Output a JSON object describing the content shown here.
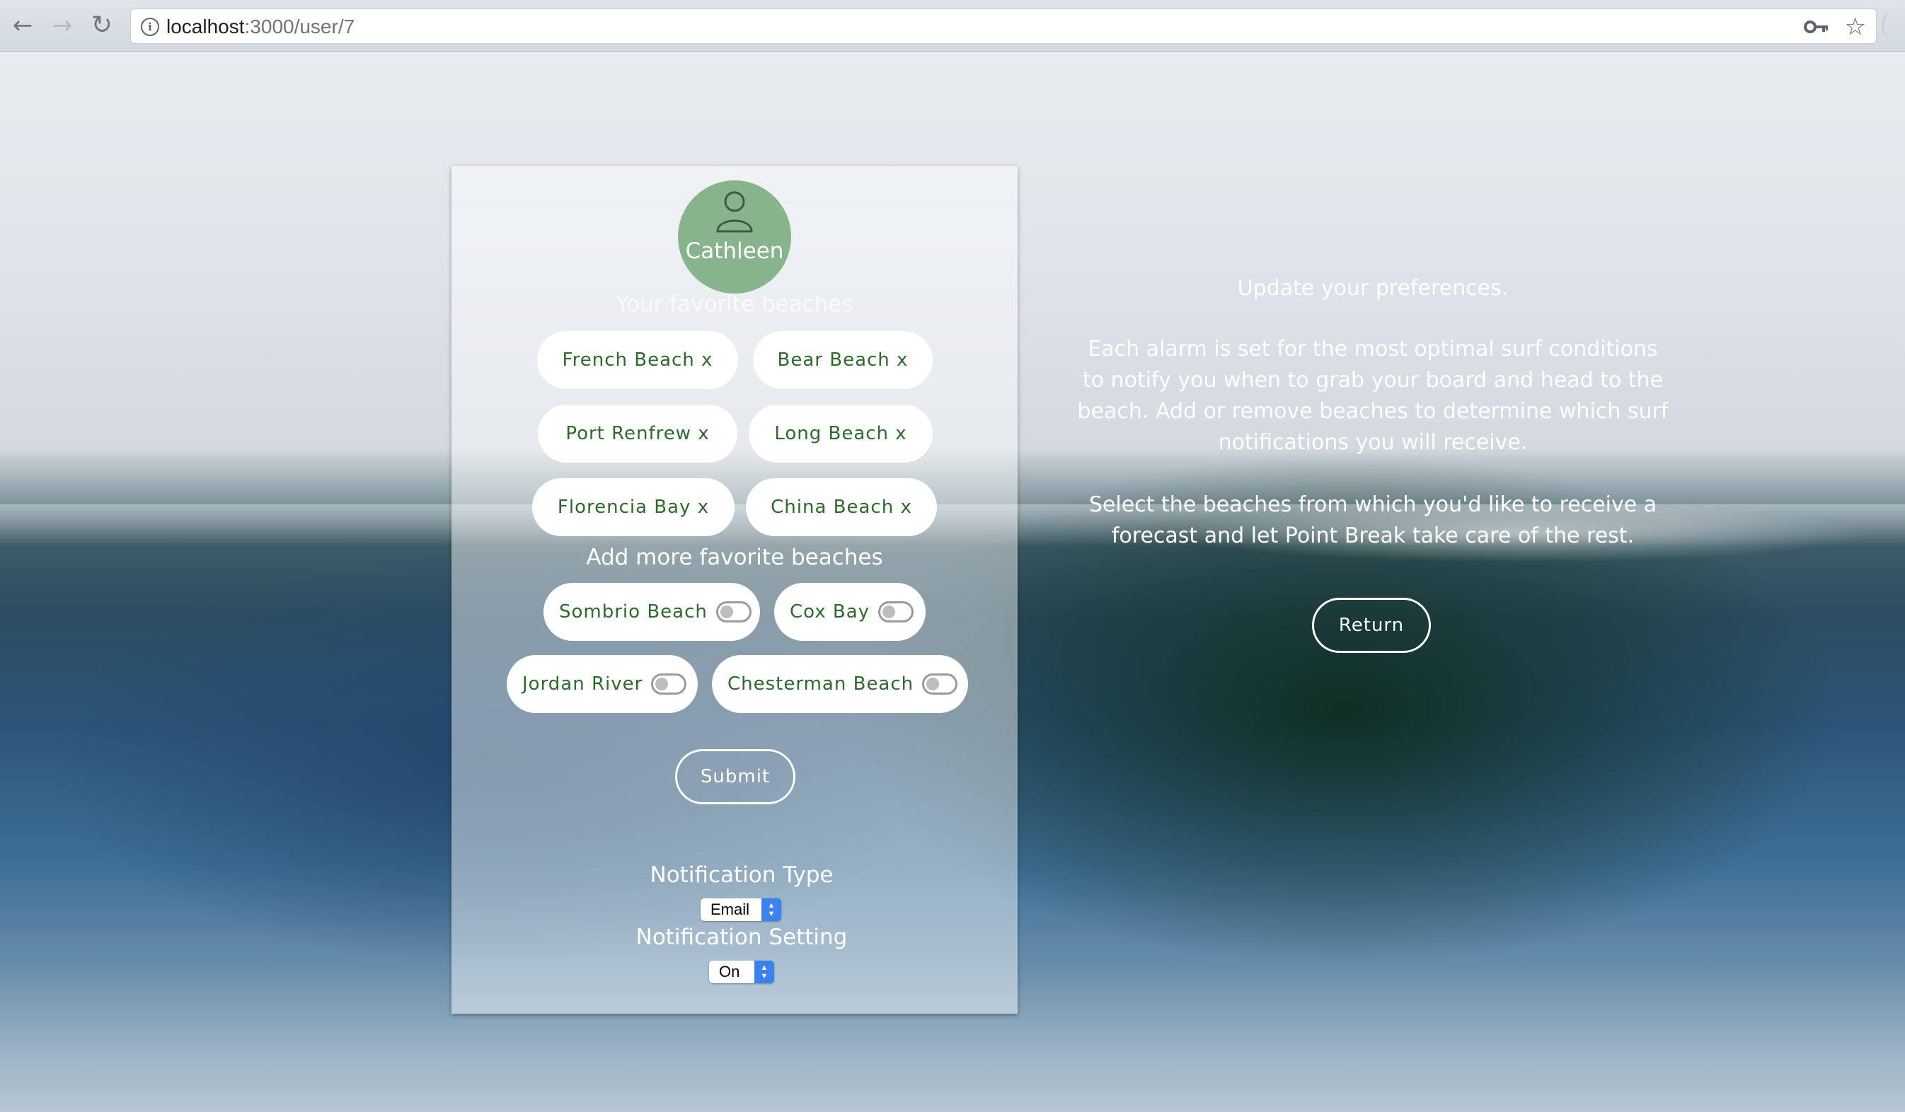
{
  "browser": {
    "url_host": "localhost",
    "url_path": ":3000/user/7",
    "icons": [
      "back-arrow-icon",
      "forward-arrow-icon",
      "reload-icon",
      "info-icon",
      "key-icon",
      "star-icon"
    ]
  },
  "profile": {
    "name": "Cathleen",
    "favorites_title": "Your favorite beaches",
    "favorites": [
      {
        "label": "French Beach x"
      },
      {
        "label": "Bear Beach x"
      },
      {
        "label": "Port Renfrew x"
      },
      {
        "label": "Long Beach x"
      },
      {
        "label": "Florencia Bay x"
      },
      {
        "label": "China Beach x"
      }
    ],
    "add_title": "Add more favorite beaches",
    "add_beaches": [
      {
        "label": "Sombrio Beach",
        "on": false
      },
      {
        "label": "Cox Bay",
        "on": false
      },
      {
        "label": "Jordan River",
        "on": false
      },
      {
        "label": "Chesterman Beach",
        "on": false
      }
    ],
    "submit_label": "Submit",
    "notification_type_label": "Notification Type",
    "notification_type_value": "Email",
    "notification_setting_label": "Notification Setting",
    "notification_setting_value": "On"
  },
  "info": {
    "heading": "Update your preferences.",
    "paragraph1": "Each alarm is set for the most optimal surf conditions to notify you when to grab your board and head to the beach. Add or remove beaches to determine which surf notifications you will receive.",
    "paragraph2": "Select the beaches from which you'd like to receive a forecast and let Point Break take care of the rest.",
    "return_label": "Return"
  },
  "colors": {
    "accent_green": "#88b48d",
    "chip_text": "#2e6a2c",
    "select_arrow": "#3b82f0"
  }
}
